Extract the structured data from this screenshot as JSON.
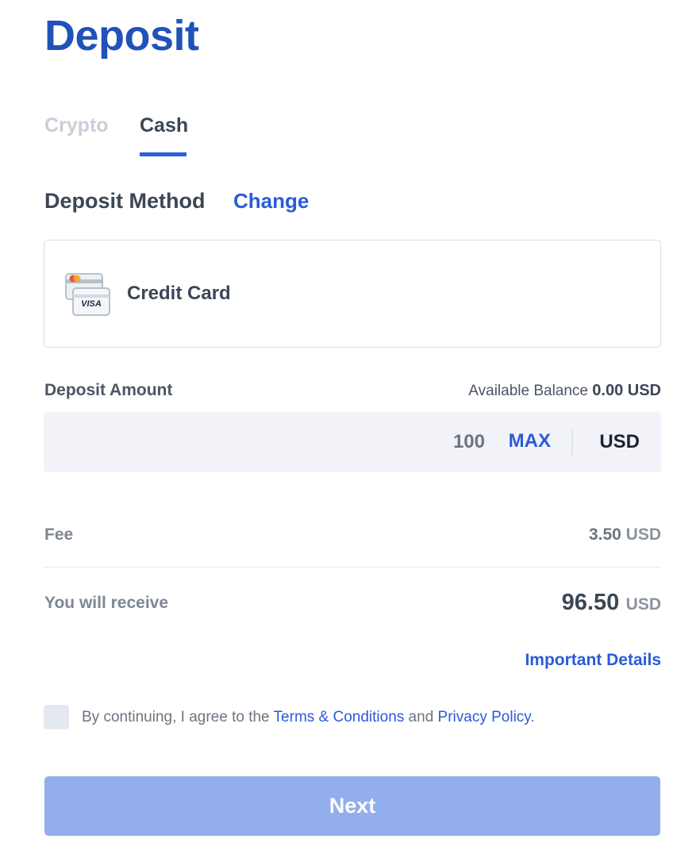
{
  "page": {
    "title": "Deposit"
  },
  "tabs": [
    {
      "label": "Crypto",
      "active": false
    },
    {
      "label": "Cash",
      "active": true
    }
  ],
  "method": {
    "label": "Deposit Method",
    "change_label": "Change",
    "selected": "Credit Card",
    "icon": "credit-card-icon",
    "card_brand_text": "VISA"
  },
  "amount": {
    "label": "Deposit Amount",
    "balance_label": "Available Balance",
    "balance_value": "0.00 USD",
    "value": "100",
    "max_label": "MAX",
    "currency": "USD"
  },
  "fee": {
    "label": "Fee",
    "value": "3.50",
    "unit": "USD"
  },
  "receive": {
    "label": "You will receive",
    "value": "96.50",
    "unit": "USD"
  },
  "details_link": "Important Details",
  "agreement": {
    "prefix": "By continuing, I agree to the ",
    "terms": "Terms & Conditions",
    "middle": " and ",
    "privacy": "Privacy Policy",
    "suffix": ".",
    "checked": false
  },
  "next_label": "Next",
  "colors": {
    "brand_blue": "#2152b8",
    "link_blue": "#2a5bd7",
    "button_disabled": "#93aeec",
    "input_bg": "#f1f3f8"
  }
}
